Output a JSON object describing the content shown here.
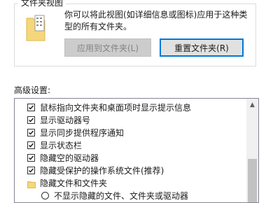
{
  "folder_views": {
    "group_title": "文件夹视图",
    "description": "你可以将此视图(如详细信息或图标)应用于这种类型的所有文件夹。",
    "apply_button": "应用到文件夹(L)",
    "reset_button": "重置文件夹(R)",
    "folder_icon_color": "#f5d77b"
  },
  "advanced": {
    "label": "高级设置:",
    "items": [
      {
        "type": "checkbox",
        "checked": true,
        "label": "鼠标指向文件夹和桌面项时显示提示信息"
      },
      {
        "type": "checkbox",
        "checked": true,
        "label": "显示驱动器号"
      },
      {
        "type": "checkbox",
        "checked": true,
        "label": "显示同步提供程序通知"
      },
      {
        "type": "checkbox",
        "checked": true,
        "label": "显示状态栏"
      },
      {
        "type": "checkbox",
        "checked": true,
        "label": "隐藏空的驱动器"
      },
      {
        "type": "checkbox",
        "checked": true,
        "label": "隐藏受保护的操作系统文件(推荐)"
      },
      {
        "type": "folder",
        "label": "隐藏文件和文件夹"
      },
      {
        "type": "radio",
        "checked": false,
        "label": "不显示隐藏的文件、文件夹或驱动器"
      }
    ]
  }
}
